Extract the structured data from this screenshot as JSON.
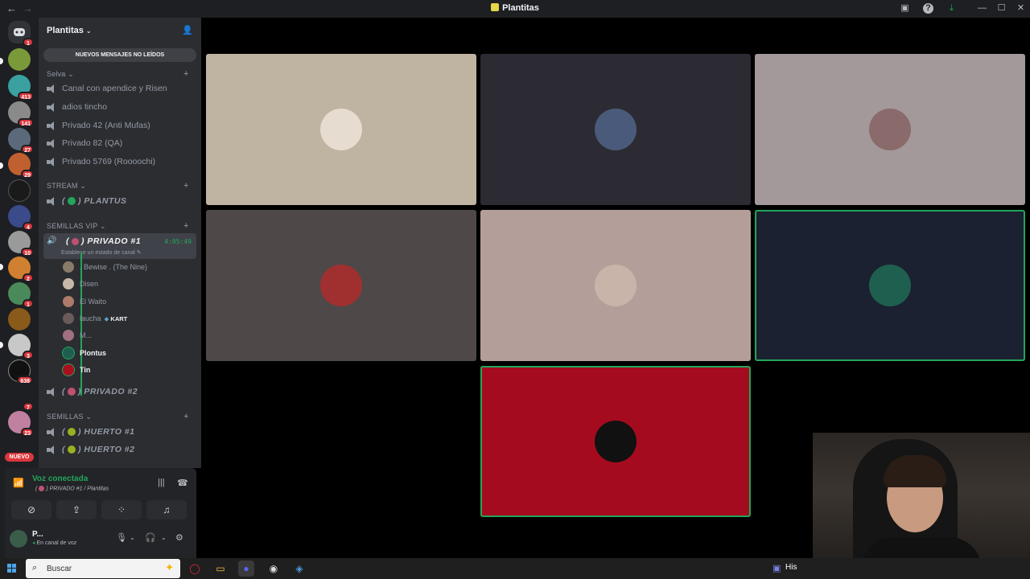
{
  "window": {
    "title": "Plantitas"
  },
  "rail": {
    "badges": [
      "1",
      "",
      "413",
      "141",
      "27",
      "29",
      "",
      "4",
      "10",
      "2",
      "1",
      "",
      "3",
      "638",
      "7",
      "23"
    ],
    "new_label": "NUEVO"
  },
  "guild": {
    "name": "Plantitas"
  },
  "unread_banner": "NUEVOS MENSAJES NO LEÍDOS",
  "categories": {
    "selva": "Selva",
    "stream": "STREAM",
    "semillas_vip": "SEMILLAS VIP",
    "semillas": "SEMILLAS"
  },
  "selva_channels": [
    "Canal con apendice y Risen",
    "adios tincho",
    "Privado 42 (Anti Mufas)",
    "Privado 82 (QA)",
    "Privado 5769 (Roooochi)"
  ],
  "stream_channel": "PLANTUS",
  "active_channel": {
    "name": "PRIVADO #1",
    "timer": "4:05:49",
    "status": "Establece un estado de canal"
  },
  "members": [
    {
      "name": ". Bewise . (The Nine)",
      "color": "#8a7a6a"
    },
    {
      "name": "Disen",
      "color": "#c8b8a8"
    },
    {
      "name": "El Waito",
      "color": "#b07a6a"
    },
    {
      "name": "laucha",
      "color": "#6a5a5a",
      "tag": "KART"
    },
    {
      "name": "M...",
      "color": "#a07080"
    },
    {
      "name": "Plontus",
      "color": "#1f5f4f"
    },
    {
      "name": "Tin",
      "color": "#a8101e"
    }
  ],
  "privado2": "PRIVADO #2",
  "semillas_channels": [
    "HUERTO #1",
    "HUERTO #2"
  ],
  "voice_panel": {
    "title": "Voz conectada",
    "subtitle": "PRIVADO #1 / Plantitas"
  },
  "user_panel": {
    "name": "P...",
    "status": "En canal de voz"
  },
  "tiles": [
    {
      "bg": "#bfb3a2",
      "avatar": "#e6ddd0"
    },
    {
      "bg": "#2c2b33",
      "avatar": "#4a5a7a"
    },
    {
      "bg": "#a3999b",
      "avatar": "#8a6a6a"
    },
    {
      "bg": "#4f4848",
      "avatar": "#a03030"
    },
    {
      "bg": "#b49e99",
      "avatar": "#c8b4a8"
    },
    {
      "bg": "#1b2131",
      "avatar": "#1f5f4f"
    },
    {
      "bg": "#a50b1e",
      "avatar": "#c41a28"
    }
  ],
  "taskbar": {
    "search_placeholder": "Buscar",
    "his": "His"
  }
}
